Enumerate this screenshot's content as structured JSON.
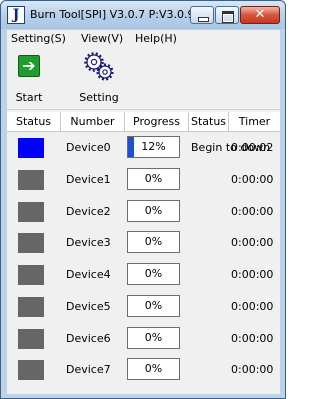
{
  "window": {
    "title": "Burn Tool[SPI] V3.0.7 P:V3.0.9",
    "close_glyph": "✕"
  },
  "menu": {
    "items": [
      "Setting(S)",
      "View(V)",
      "Help(H)"
    ]
  },
  "toolbar": {
    "start_label": "Start",
    "setting_label": "Setting"
  },
  "table": {
    "columns": [
      "Status",
      "Number",
      "Progress",
      "Status",
      "Timer"
    ],
    "rows": [
      {
        "status_color": "#0000ff",
        "number": "Device0",
        "progress_text": "12%",
        "progress": 0.12,
        "status": "Begin to down",
        "timer": "0:00:02"
      },
      {
        "status_color": "#666666",
        "number": "Device1",
        "progress_text": "0%",
        "progress": 0,
        "status": "",
        "timer": "0:00:00"
      },
      {
        "status_color": "#666666",
        "number": "Device2",
        "progress_text": "0%",
        "progress": 0,
        "status": "",
        "timer": "0:00:00"
      },
      {
        "status_color": "#666666",
        "number": "Device3",
        "progress_text": "0%",
        "progress": 0,
        "status": "",
        "timer": "0:00:00"
      },
      {
        "status_color": "#666666",
        "number": "Device4",
        "progress_text": "0%",
        "progress": 0,
        "status": "",
        "timer": "0:00:00"
      },
      {
        "status_color": "#666666",
        "number": "Device5",
        "progress_text": "0%",
        "progress": 0,
        "status": "",
        "timer": "0:00:00"
      },
      {
        "status_color": "#666666",
        "number": "Device6",
        "progress_text": "0%",
        "progress": 0,
        "status": "",
        "timer": "0:00:00"
      },
      {
        "status_color": "#666666",
        "number": "Device7",
        "progress_text": "0%",
        "progress": 0,
        "status": "",
        "timer": "0:00:00"
      }
    ]
  }
}
